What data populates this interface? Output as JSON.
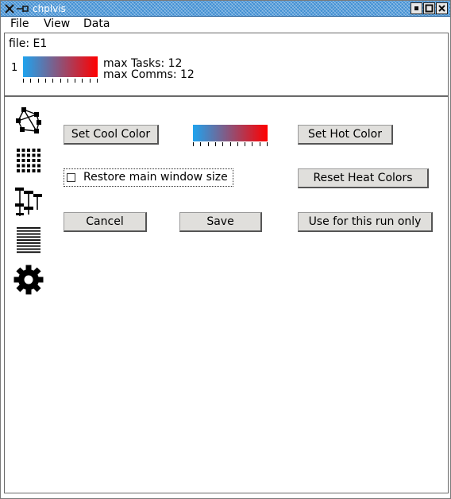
{
  "window": {
    "title": "chplvis",
    "title_bar_color": "#3f8ed2"
  },
  "menu": {
    "items": [
      "File",
      "View",
      "Data"
    ]
  },
  "header": {
    "file_label": "file: E1",
    "locale_number": "1",
    "max_tasks": "max Tasks: 12",
    "max_comms": "max Comms: 12",
    "heat_colors": {
      "cool": "#1fa3ee",
      "hot": "#ff0000"
    }
  },
  "sidebar": {
    "icons": [
      "graph-view-icon",
      "grid-view-icon",
      "concurrency-view-icon",
      "list-view-icon",
      "settings-gear-icon"
    ]
  },
  "settings": {
    "set_cool_color": "Set Cool Color",
    "set_hot_color": "Set Hot Color",
    "restore_window_size_label": "Restore main window size",
    "restore_window_size_checked": false,
    "reset_heat_colors": "Reset Heat Colors",
    "cancel": "Cancel",
    "save": "Save",
    "use_for_this_run_only": "Use for this run only"
  }
}
